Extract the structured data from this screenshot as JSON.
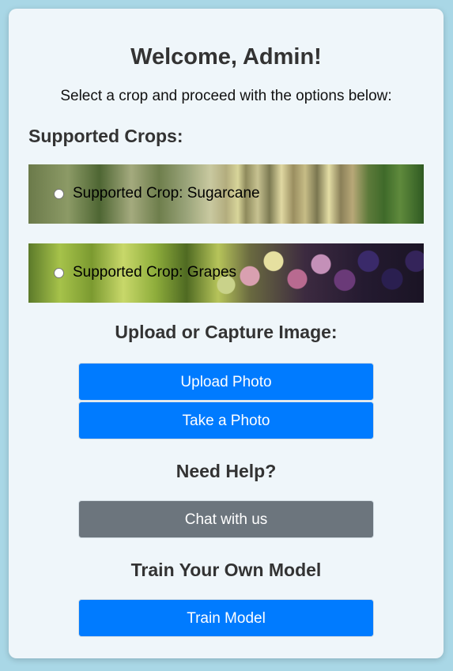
{
  "header": {
    "title": "Welcome, Admin!",
    "subtitle": "Select a crop and proceed with the options below:"
  },
  "crops": {
    "heading": "Supported Crops:",
    "items": [
      {
        "label": "Supported Crop: Sugarcane",
        "selected": false,
        "image": "sugarcane-image"
      },
      {
        "label": "Supported Crop: Grapes",
        "selected": false,
        "image": "grapes-image"
      }
    ]
  },
  "upload": {
    "heading": "Upload or Capture Image:",
    "upload_label": "Upload Photo",
    "capture_label": "Take a Photo"
  },
  "help": {
    "heading": "Need Help?",
    "chat_label": "Chat with us"
  },
  "train": {
    "heading": "Train Your Own Model",
    "train_label": "Train Model"
  },
  "colors": {
    "background": "#a9d7e6",
    "card": "#eff6fa",
    "primary": "#007bff",
    "secondary": "#6c757d",
    "heading_text": "#333333"
  }
}
